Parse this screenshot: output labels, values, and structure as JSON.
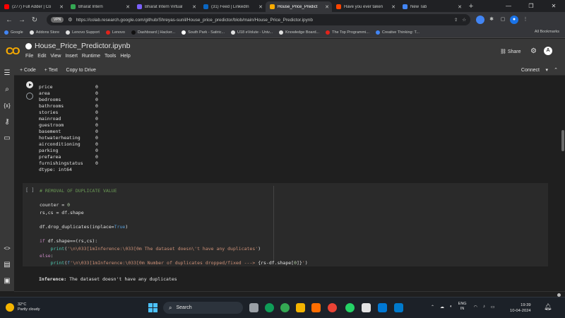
{
  "browser": {
    "tabs": [
      {
        "title": "(277) Full Adder | Co",
        "color": "#ff0000"
      },
      {
        "title": "Bharat Intern",
        "color": "#34a853"
      },
      {
        "title": "Bharat Intern Virtual",
        "color": "#7b61ff"
      },
      {
        "title": "(31) Feed | LinkedIn",
        "color": "#0a66c2"
      },
      {
        "title": "House_Price_Predict",
        "color": "#f9ab00",
        "active": true
      },
      {
        "title": "Have you ever taken",
        "color": "#ff4500"
      },
      {
        "title": "New Tab",
        "color": "#4285f4"
      }
    ],
    "new_tab_label": "+",
    "vpn_label": "VPN",
    "url": "https://colab.research.google.com/github/Shreyas-sunil/House_price_predictor/blob/main/House_Price_Predictor.ipynb",
    "bookmarks": [
      {
        "label": "Google",
        "color": "#4285f4"
      },
      {
        "label": "Addons Store",
        "color": "#e0e0e0"
      },
      {
        "label": "Lenovo Support",
        "color": "#e0e0e0"
      },
      {
        "label": "Lenovo",
        "color": "#e2231a"
      },
      {
        "label": "Dashboard | Hacker...",
        "color": "#111111"
      },
      {
        "label": "South Park - Satiric...",
        "color": "#ffffff"
      },
      {
        "label": "U18 eVolute - Univ...",
        "color": "#e0e0e0"
      },
      {
        "label": "Knowledge Board...",
        "color": "#e0e0e0"
      },
      {
        "label": "The Top Programmi...",
        "color": "#e2231a"
      },
      {
        "label": "Creative Thinking: T...",
        "color": "#4285f4"
      }
    ],
    "all_bookmarks": "All Bookmarks"
  },
  "colab": {
    "notebook_title": "House_Price_Predictor.ipynb",
    "menus": [
      "File",
      "Edit",
      "View",
      "Insert",
      "Runtime",
      "Tools",
      "Help"
    ],
    "share_label": "Share",
    "avatar_letter": "A",
    "toolbar": {
      "add_code": "+ Code",
      "add_text": "+ Text",
      "copy_to_drive": "Copy to Drive",
      "connect": "Connect"
    },
    "output_rows": [
      {
        "name": "price",
        "value": "0"
      },
      {
        "name": "area",
        "value": "0"
      },
      {
        "name": "bedrooms",
        "value": "0"
      },
      {
        "name": "bathrooms",
        "value": "0"
      },
      {
        "name": "stories",
        "value": "0"
      },
      {
        "name": "mainroad",
        "value": "0"
      },
      {
        "name": "guestroom",
        "value": "0"
      },
      {
        "name": "basement",
        "value": "0"
      },
      {
        "name": "hotwaterheating",
        "value": "0"
      },
      {
        "name": "airconditioning",
        "value": "0"
      },
      {
        "name": "parking",
        "value": "0"
      },
      {
        "name": "prefarea",
        "value": "0"
      },
      {
        "name": "furnishingstatus",
        "value": "0"
      }
    ],
    "dtype_line": "dtype: int64",
    "cell_prompt": "[ ]",
    "inference_label": "Inference:",
    "inference_text": "The dataset doesn't have any duplicates"
  },
  "taskbar": {
    "temperature": "32°C",
    "weather": "Partly cloudy",
    "search_label": "Search",
    "lang_line1": "ENG",
    "lang_line2": "IN",
    "time": "19:39",
    "date": "10-04-2024",
    "notification_count": "1"
  }
}
